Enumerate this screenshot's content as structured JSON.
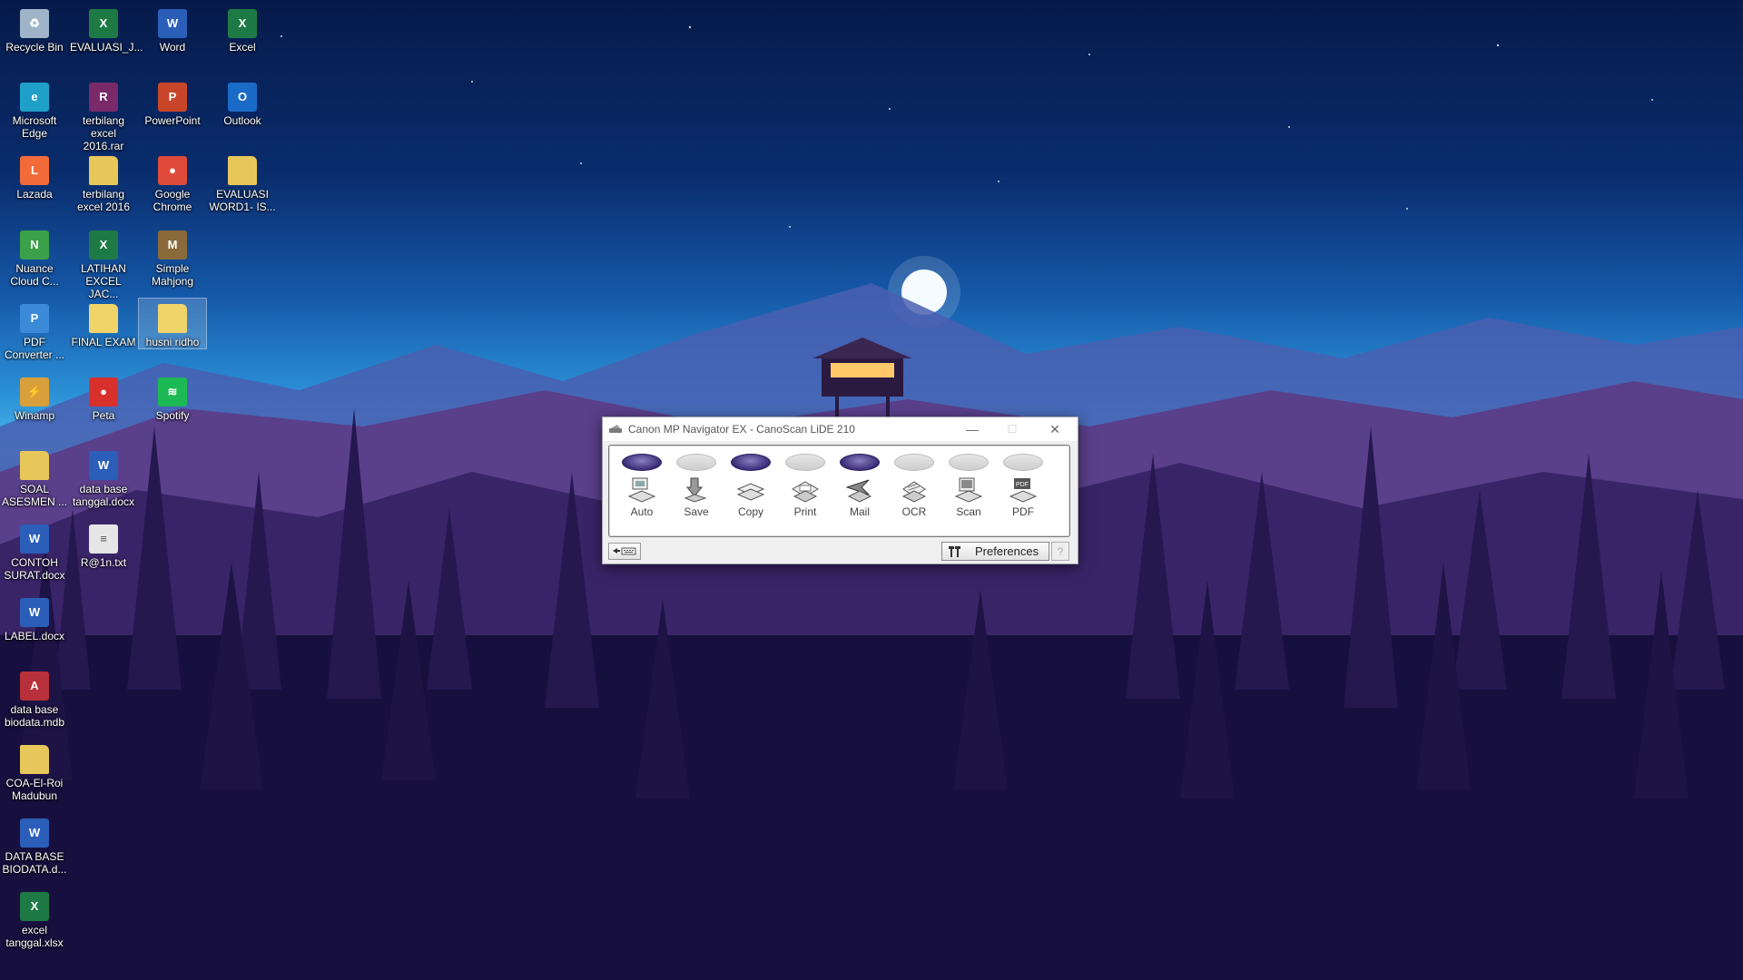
{
  "desktop": {
    "icons": [
      {
        "label": "Recycle Bin",
        "icon": "recycle-bin-icon",
        "color": "#9fb4c8"
      },
      {
        "label": "EVALUASI_J...",
        "icon": "excel-file-icon",
        "color": "#1e7a45"
      },
      {
        "label": "Word",
        "icon": "word-icon",
        "color": "#2b5eb8"
      },
      {
        "label": "Excel",
        "icon": "excel-icon",
        "color": "#1e7a45"
      },
      {
        "label": "Microsoft Edge",
        "icon": "edge-icon",
        "color": "#1fa0c8"
      },
      {
        "label": "terbilang excel 2016.rar",
        "icon": "winrar-icon",
        "color": "#7a2a6a"
      },
      {
        "label": "PowerPoint",
        "icon": "powerpoint-icon",
        "color": "#c8452a"
      },
      {
        "label": "Outlook",
        "icon": "outlook-icon",
        "color": "#1a6ac8"
      },
      {
        "label": "Lazada",
        "icon": "lazada-icon",
        "color": "#f26a3a"
      },
      {
        "label": "terbilang excel 2016",
        "icon": "folder-icon",
        "color": "#e8c75a"
      },
      {
        "label": "Google Chrome",
        "icon": "chrome-icon",
        "color": "#e04a3a"
      },
      {
        "label": "EVALUASI WORD1- IS...",
        "icon": "folder-icon",
        "color": "#e8c75a"
      },
      {
        "label": "Nuance Cloud C...",
        "icon": "nuance-icon",
        "color": "#3aa04a"
      },
      {
        "label": "LATIHAN EXCEL JAC...",
        "icon": "excel-file-icon",
        "color": "#1e7a45"
      },
      {
        "label": "Simple Mahjong",
        "icon": "mahjong-icon",
        "color": "#8a6a3a"
      },
      {
        "label": "PDF Converter ...",
        "icon": "pdf-converter-icon",
        "color": "#3a8ad8"
      },
      {
        "label": "FINAL EXAM",
        "icon": "folder-icon",
        "color": "#f0d46a"
      },
      {
        "label": "husni ridho",
        "icon": "folder-icon",
        "color": "#f0d46a"
      },
      {
        "label": "Winamp",
        "icon": "winamp-icon",
        "color": "#d8a03a"
      },
      {
        "label": "Peta",
        "icon": "map-pin-icon",
        "color": "#d8302a"
      },
      {
        "label": "Spotify",
        "icon": "spotify-icon",
        "color": "#1db954"
      },
      {
        "label": "SOAL ASESMEN ...",
        "icon": "folder-icon",
        "color": "#e8c75a"
      },
      {
        "label": "data base tanggal.docx",
        "icon": "word-file-icon",
        "color": "#2b5eb8"
      },
      {
        "label": "CONTOH SURAT.docx",
        "icon": "word-file-icon",
        "color": "#2b5eb8"
      },
      {
        "label": "R@1n.txt",
        "icon": "text-file-icon",
        "color": "#e6e6e6"
      },
      {
        "label": "LABEL.docx",
        "icon": "word-file-icon",
        "color": "#2b5eb8"
      },
      {
        "label": "data base biodata.mdb",
        "icon": "access-file-icon",
        "color": "#b8303a"
      },
      {
        "label": "COA-El-Roi Madubun",
        "icon": "folder-icon",
        "color": "#e8c75a"
      },
      {
        "label": "DATA BASE BIODATA.d...",
        "icon": "word-file-icon",
        "color": "#2b5eb8"
      },
      {
        "label": "excel tanggal.xlsx",
        "icon": "excel-file-icon",
        "color": "#1e7a45"
      }
    ]
  },
  "window": {
    "title": "Canon MP Navigator EX - CanoScan LiDE 210",
    "minimize": "—",
    "maximize": "☐",
    "close": "✕",
    "tools": [
      {
        "label": "Auto",
        "active": true
      },
      {
        "label": "Save",
        "active": false
      },
      {
        "label": "Copy",
        "active": true
      },
      {
        "label": "Print",
        "active": false
      },
      {
        "label": "Mail",
        "active": true
      },
      {
        "label": "OCR",
        "active": false
      },
      {
        "label": "Scan",
        "active": false
      },
      {
        "label": "PDF",
        "active": false
      }
    ],
    "preferences_label": "Preferences",
    "help_label": "?"
  }
}
